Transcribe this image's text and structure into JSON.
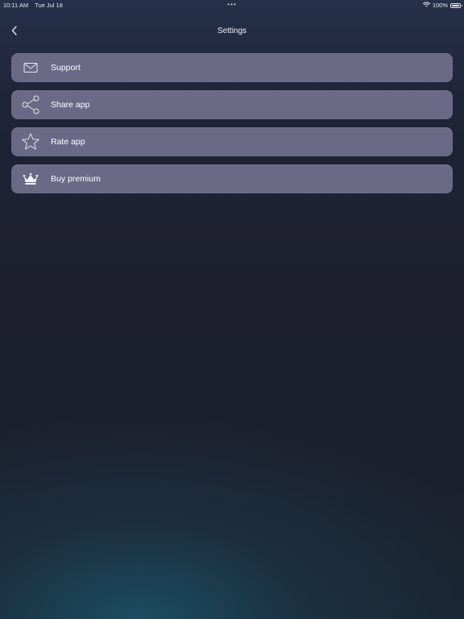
{
  "status_bar": {
    "time": "10:11 AM",
    "date": "Tue Jul 18",
    "dots": "•••",
    "battery": "100%",
    "wifi_icon": "wifi-icon",
    "battery_icon": "battery-icon"
  },
  "nav": {
    "title": "Settings",
    "back_icon": "chevron-left-icon"
  },
  "menu": {
    "items": [
      {
        "label": "Support",
        "icon": "envelope-icon"
      },
      {
        "label": "Share app",
        "icon": "share-icon"
      },
      {
        "label": "Rate app",
        "icon": "star-icon"
      },
      {
        "label": "Buy premium",
        "icon": "crown-icon"
      }
    ]
  },
  "colors": {
    "background": "#1d1f2d",
    "menu_item_bg": "#6a6a86",
    "text": "#ffffff"
  }
}
